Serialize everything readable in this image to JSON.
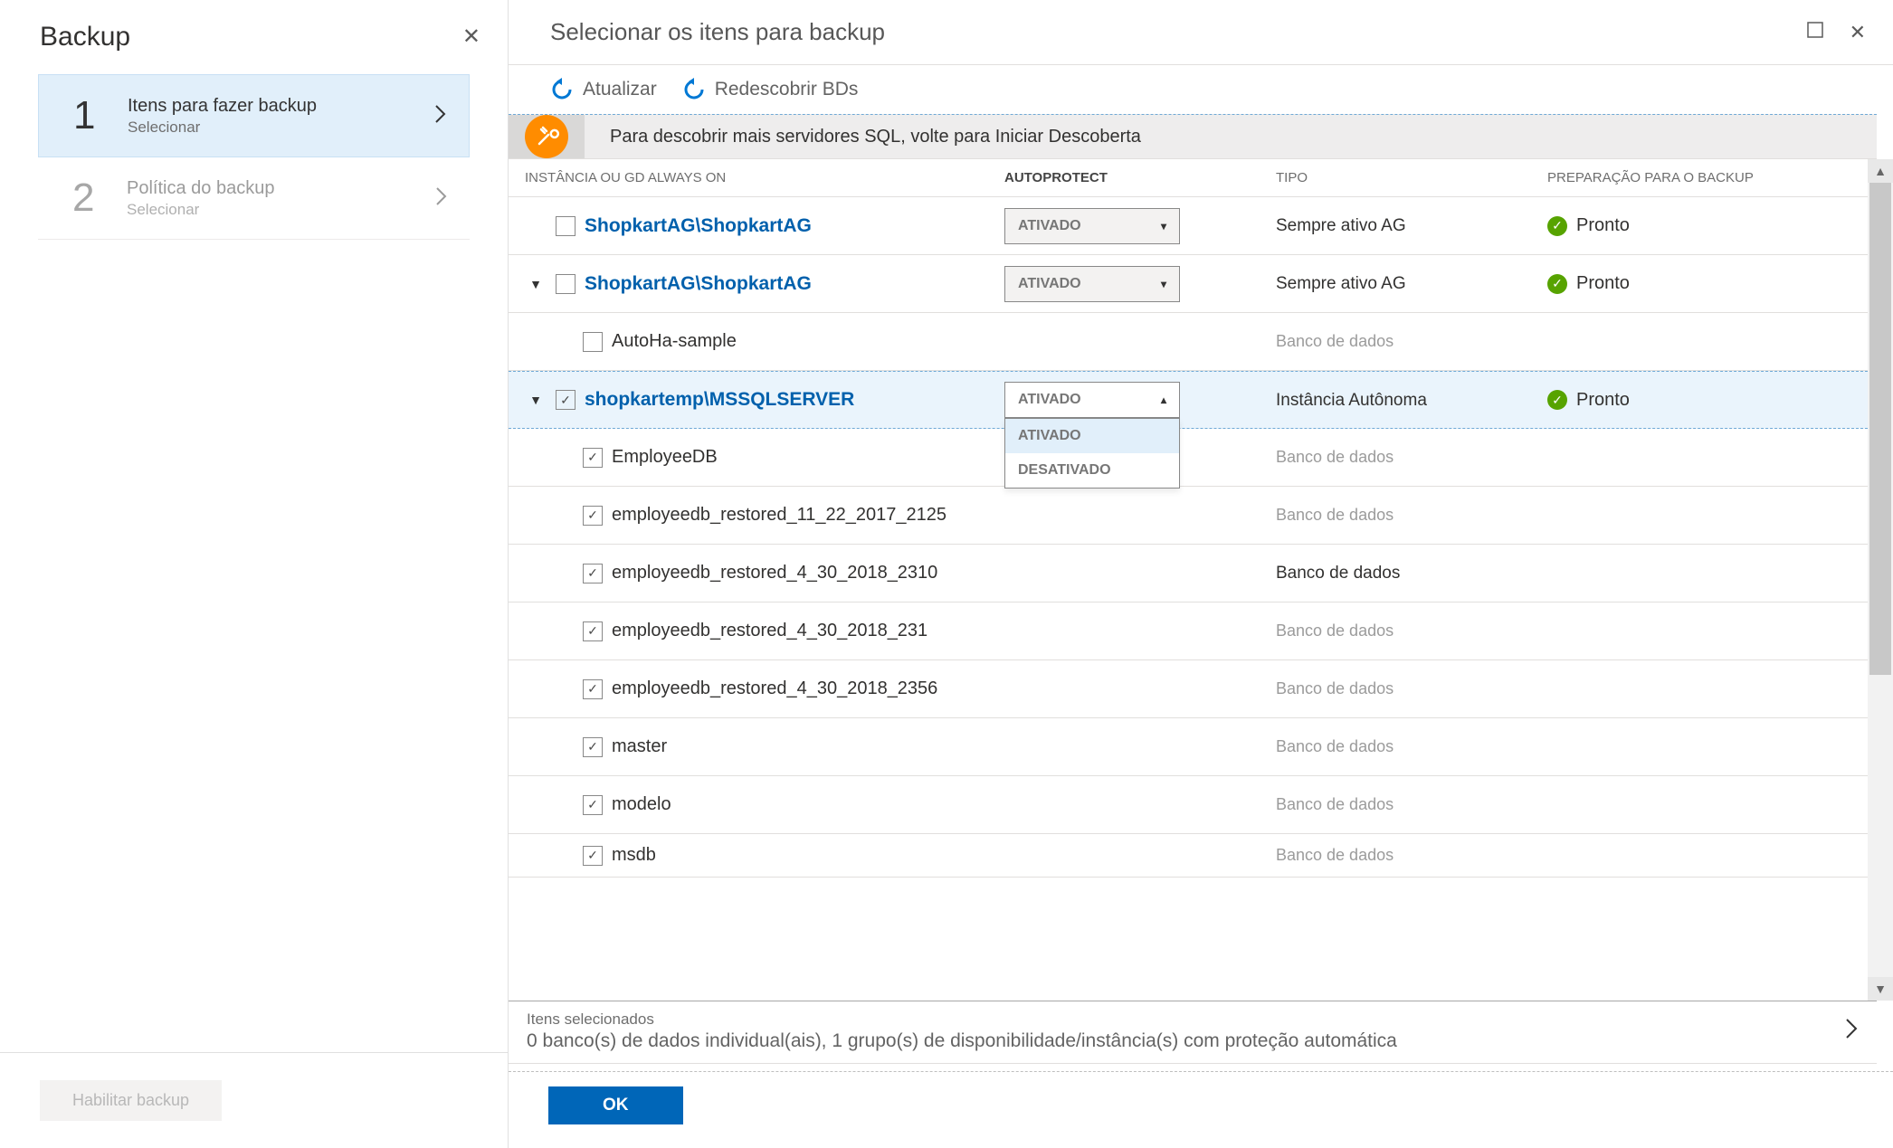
{
  "left": {
    "title": "Backup",
    "steps": [
      {
        "num": "1",
        "title": "Itens para fazer backup",
        "sub": "Selecionar"
      },
      {
        "num": "2",
        "title": "Política do backup",
        "sub": "Selecionar"
      }
    ],
    "enable_button": "Habilitar backup"
  },
  "right": {
    "title": "Selecionar os itens para backup",
    "toolbar": {
      "refresh": "Atualizar",
      "rediscover": "Redescobrir BDs"
    },
    "info_bar": "Para descobrir mais servidores SQL, volte para Iniciar Descoberta",
    "columns": {
      "instance": "INSTÂNCIA OU GD ALWAYS ON",
      "autoprotect": "AUTOPROTECT",
      "tipo": "TIPO",
      "prep": "PREPARAÇÃO PARA O BACKUP"
    },
    "autoprotect_value": "ATIVADO",
    "dropdown_options": {
      "on": "ATIVADO",
      "off": "DESATIVADO"
    },
    "tipo_values": {
      "ag": "Sempre ativo AG",
      "db": "Banco de dados",
      "standalone": "Instância Autônoma"
    },
    "ready_label": "Pronto",
    "rows": [
      {
        "name": "ShopkartAG\\ShopkartAG"
      },
      {
        "name": "ShopkartAG\\ShopkartAG"
      },
      {
        "name": "AutoHa-sample"
      },
      {
        "name": "shopkartemp\\MSSQLSERVER"
      },
      {
        "name": "EmployeeDB"
      },
      {
        "name": "employeedb_restored_11_22_2017_2125"
      },
      {
        "name": "employeedb_restored_4_30_2018_2310"
      },
      {
        "name": "employeedb_restored_4_30_2018_231"
      },
      {
        "name": "employeedb_restored_4_30_2018_2356"
      },
      {
        "name": "master"
      },
      {
        "name": "modelo"
      },
      {
        "name": "msdb"
      }
    ],
    "footer": {
      "label": "Itens selecionados",
      "desc": "0 banco(s) de dados individual(ais), 1 grupo(s) de disponibilidade/instância(s) com proteção automática"
    },
    "ok_button": "OK"
  }
}
